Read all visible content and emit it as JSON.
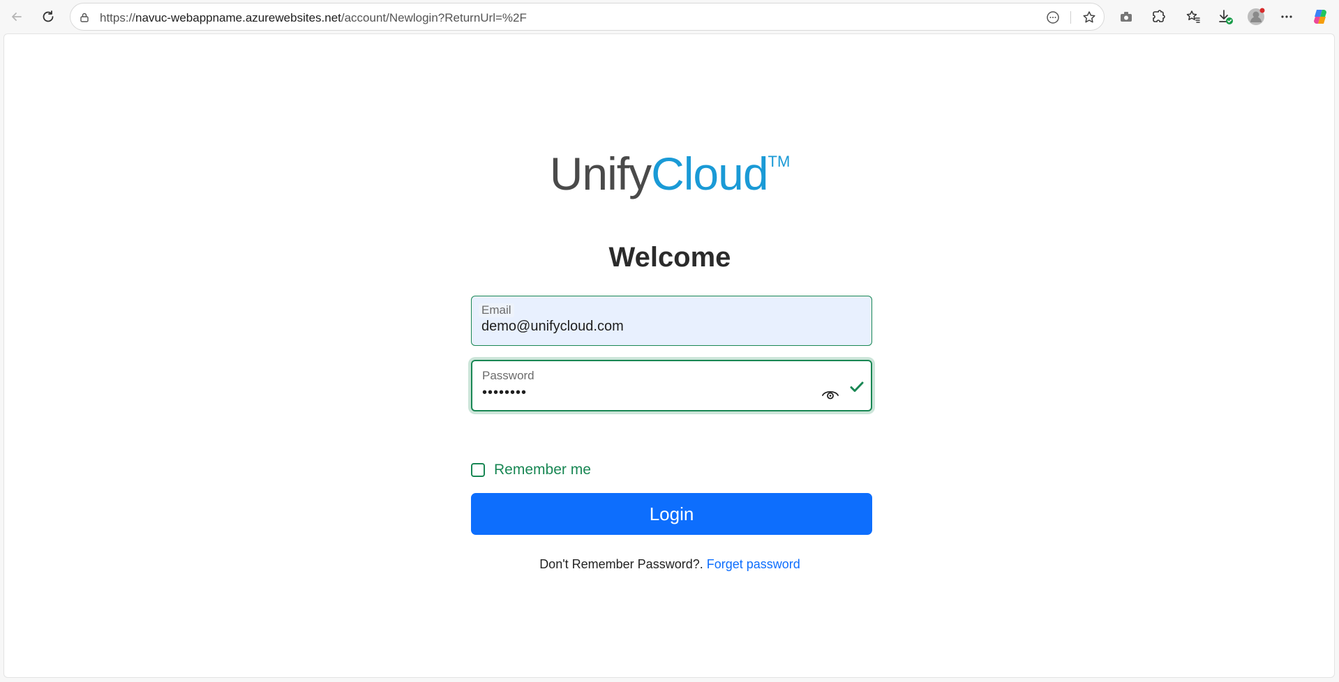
{
  "browser": {
    "url_scheme": "https://",
    "url_host": "navuc-webappname.azurewebsites.net",
    "url_path": "/account/Newlogin?ReturnUrl=%2F",
    "icons": [
      "back-arrow-icon",
      "refresh-icon",
      "site-info-icon",
      "read-aloud-icon",
      "favorite-star-icon",
      "screenshot-icon",
      "extensions-icon",
      "favorites-icon",
      "downloads-icon",
      "profile-icon",
      "more-icon",
      "copilot-icon"
    ]
  },
  "brand": {
    "part1": "Unify",
    "part2": "Cloud",
    "trademark": "TM",
    "colors": {
      "gray": "#4a4a4a",
      "blue": "#1a9ad6"
    }
  },
  "login": {
    "heading": "Welcome",
    "email_label": "Email",
    "email_value": "demo@unifycloud.com",
    "password_label": "Password",
    "password_value": "••••••••",
    "remember_label": "Remember me",
    "remember_checked": false,
    "submit_label": "Login",
    "forgot_prefix": "Don't Remember Password?.",
    "forgot_link": "Forget password",
    "colors": {
      "valid_green": "#198754",
      "primary_blue": "#0d6efd"
    }
  }
}
